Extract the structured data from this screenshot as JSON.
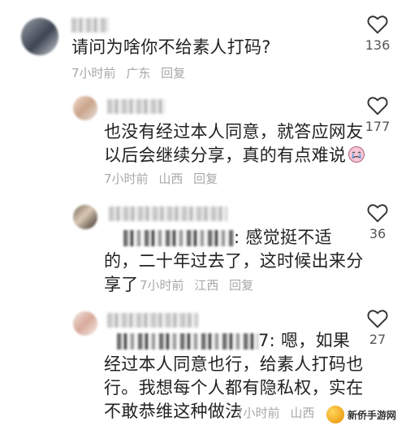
{
  "comments": [
    {
      "text": "请问为啥你不给素人打码?",
      "time": "7小时前",
      "location": "广东",
      "reply_label": "回复",
      "likes": "136"
    },
    {
      "line1": "也没有经过本人同意，就答应网友",
      "line2": "以后会继续分享，真的有点难说",
      "emoji_icon": "crying-face-emoji",
      "time": "7小时前",
      "location": "山西",
      "reply_label": "回复",
      "likes": "177"
    },
    {
      "line1_tail": ": 感觉挺不适",
      "line2": "的，二十年过去了，这时候出来分",
      "line3_text": "享了",
      "time": "7小时前",
      "location": "江西",
      "reply_label": "回复",
      "likes": "36"
    },
    {
      "line1_tail": "7: 嗯，如果",
      "line2": "经过本人同意也行，给素人打码也",
      "line3": "行。我想每个人都有隐私权，实在",
      "line4_text": "不敢恭维这种做法",
      "time": "7小时前",
      "location": "山西",
      "reply_label": "回复",
      "likes": "27"
    }
  ],
  "watermark": {
    "text": "新侨手游网"
  },
  "colors": {
    "meta": "#a8a8a8",
    "text": "#222222",
    "heart": "#333333"
  }
}
